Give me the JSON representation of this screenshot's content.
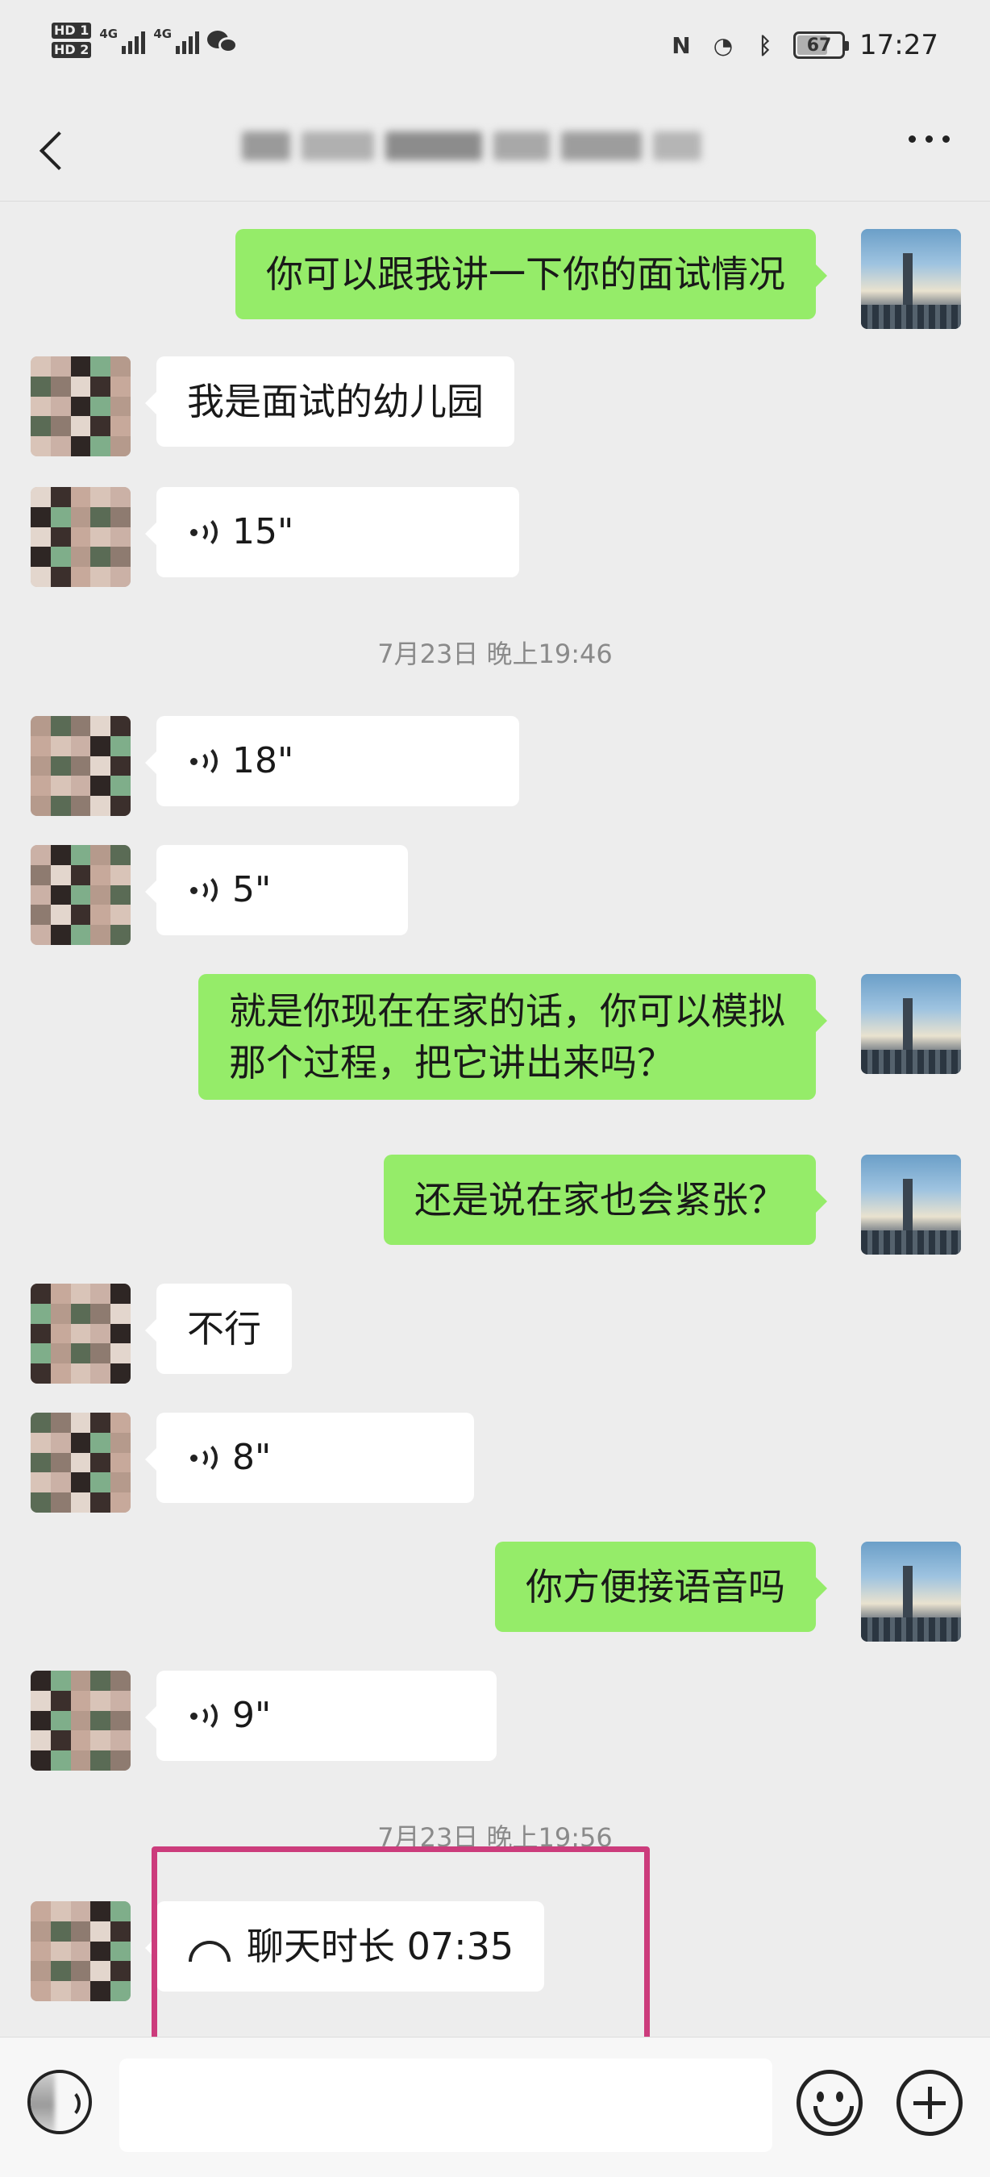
{
  "status_bar": {
    "sim1": "HD 1",
    "sim2": "HD 2",
    "net1": "4G",
    "net2": "4G",
    "battery": "67",
    "clock": "17:27",
    "icons": [
      "nfc-icon",
      "alarm-icon",
      "bluetooth-icon"
    ]
  },
  "header": {
    "back_icon": "chevron-left-icon",
    "more_icon": "more-icon"
  },
  "messages": [
    {
      "side": "me",
      "type": "text",
      "text": "你可以跟我讲一下你的面试情况"
    },
    {
      "side": "them",
      "type": "text",
      "text": "我是面试的幼儿园"
    },
    {
      "side": "them",
      "type": "voice",
      "text": "15\""
    },
    {
      "type": "time",
      "text": "7月23日 晚上19:46"
    },
    {
      "side": "them",
      "type": "voice",
      "text": "18\""
    },
    {
      "side": "them",
      "type": "voice",
      "text": "5\""
    },
    {
      "side": "me",
      "type": "text",
      "lines": [
        "就是你现在在家的话，你可以模拟",
        "那个过程，把它讲出来吗？"
      ]
    },
    {
      "side": "me",
      "type": "text",
      "text": "还是说在家也会紧张？"
    },
    {
      "side": "them",
      "type": "text",
      "text": "不行"
    },
    {
      "side": "them",
      "type": "voice",
      "text": "8\""
    },
    {
      "side": "me",
      "type": "text",
      "text": "你方便接语音吗"
    },
    {
      "side": "them",
      "type": "voice",
      "text": "9\""
    },
    {
      "type": "time",
      "text": "7月23日 晚上19:56"
    },
    {
      "side": "them",
      "type": "call",
      "text": "聊天时长 07:35"
    }
  ],
  "input_bar": {
    "voice_icon": "voice-input-icon",
    "emoji_icon": "emoji-icon",
    "plus_icon": "add-icon",
    "placeholder": ""
  },
  "colors": {
    "my_bubble": "#95ec69",
    "their_bubble": "#ffffff",
    "background": "#ededed",
    "highlight_box": "#cc3c7c"
  }
}
